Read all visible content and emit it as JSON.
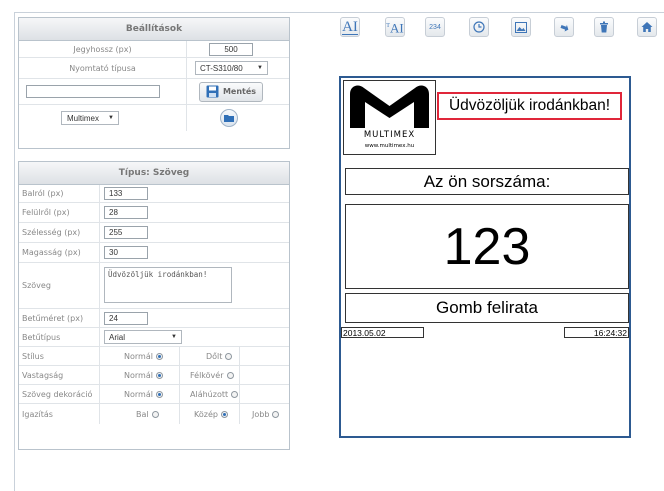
{
  "settings_panel": {
    "title": "Beállítások",
    "ticket_length_label": "Jegyhossz (px)",
    "ticket_length_value": "500",
    "printer_type_label": "Nyomtató típusa",
    "printer_type_value": "CT-S310/80",
    "name_input_value": "",
    "save_label": "Mentés",
    "template_value": "Multimex"
  },
  "type_panel": {
    "title": "Típus: Szöveg",
    "left_label": "Balról (px)",
    "left_value": "133",
    "top_label": "Felülről (px)",
    "top_value": "28",
    "width_label": "Szélesség (px)",
    "width_value": "255",
    "height_label": "Magasság (px)",
    "height_value": "30",
    "text_label": "Szöveg",
    "text_value": "Üdvözöljük irodánkban!",
    "font_size_label": "Betűméret (px)",
    "font_size_value": "24",
    "font_label": "Betűtípus",
    "font_value": "Arial",
    "style_label": "Stílus",
    "style_normal": "Normál",
    "style_italic": "Dőlt",
    "weight_label": "Vastagság",
    "weight_normal": "Normál",
    "weight_bold": "Félkövér",
    "decoration_label": "Szöveg dekoráció",
    "decoration_normal": "Normál",
    "decoration_underline": "Aláhúzott",
    "align_label": "Igazítás",
    "align_left": "Bal",
    "align_center": "Közép",
    "align_right": "Jobb"
  },
  "toolbar": {
    "text_tool": "A",
    "text_tool2": "A",
    "number_tool": "234",
    "icons": [
      "text-icon",
      "text-alt-icon",
      "number-icon",
      "clock-icon",
      "image-icon",
      "arrow-down-icon",
      "delete-icon",
      "home-icon"
    ]
  },
  "ticket": {
    "logo_text": "MULTIMEX",
    "logo_url": "www.multimex.hu",
    "welcome": "Üdvözöljük irodánkban!",
    "your_number": "Az ön sorszáma:",
    "number": "123",
    "button_caption": "Gomb felirata",
    "date": "2013.05.02",
    "time": "16:24:32"
  },
  "colors": {
    "accent": "#3f76b8",
    "frame": "#2d5a91",
    "highlight": "#e0263a"
  }
}
